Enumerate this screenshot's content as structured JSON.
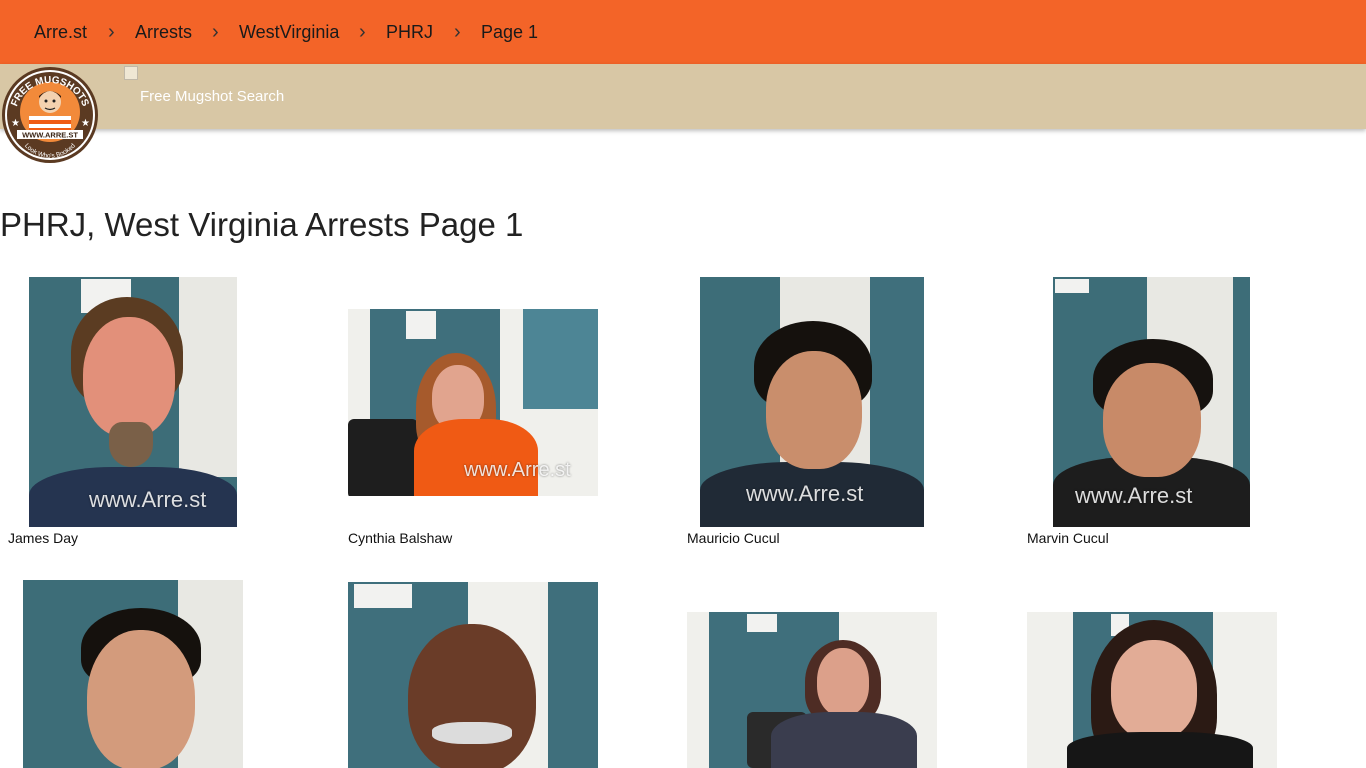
{
  "breadcrumb": [
    {
      "label": "Arre.st"
    },
    {
      "label": "Arrests"
    },
    {
      "label": "WestVirginia"
    },
    {
      "label": "PHRJ"
    },
    {
      "label": "Page 1"
    }
  ],
  "separator": "›",
  "subnav": {
    "link_label": "Free Mugshot Search"
  },
  "logo": {
    "top_text": "FREE MUGSHOTS",
    "url_text": "WWW.ARRE.ST",
    "bottom_text": "Look Who's Booked"
  },
  "page_title": "PHRJ, West Virginia Arrests Page 1",
  "watermark": "www.Arre.st",
  "arrests": [
    {
      "name": "James Day"
    },
    {
      "name": "Cynthia Balshaw"
    },
    {
      "name": "Mauricio Cucul"
    },
    {
      "name": "Marvin Cucul"
    },
    {
      "name": ""
    },
    {
      "name": ""
    },
    {
      "name": ""
    },
    {
      "name": ""
    }
  ],
  "colors": {
    "topbar": "#f36428",
    "subbar": "#d8c7a5",
    "door_teal": "#3f6f7c",
    "orange_jumpsuit": "#f05a14"
  }
}
